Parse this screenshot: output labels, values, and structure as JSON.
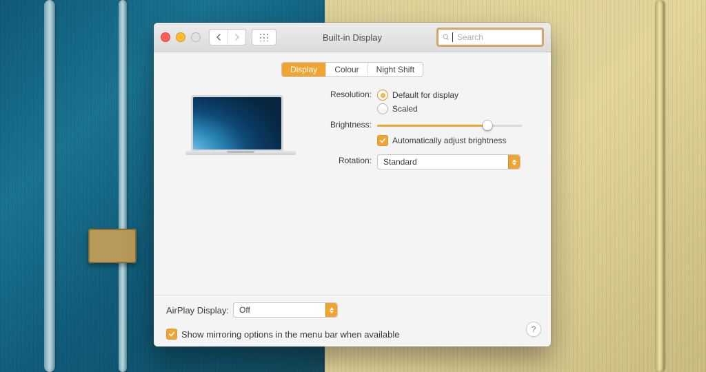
{
  "window": {
    "title": "Built-in Display",
    "search_placeholder": "Search",
    "search_value": ""
  },
  "tabs": {
    "items": [
      "Display",
      "Colour",
      "Night Shift"
    ],
    "active_index": 0
  },
  "form": {
    "resolution_label": "Resolution:",
    "resolution_default": "Default for display",
    "resolution_scaled": "Scaled",
    "resolution_selected": "default",
    "brightness_label": "Brightness:",
    "brightness_percent": 78,
    "auto_brightness_label": "Automatically adjust brightness",
    "auto_brightness_checked": true,
    "rotation_label": "Rotation:",
    "rotation_value": "Standard"
  },
  "footer": {
    "airplay_label": "AirPlay Display:",
    "airplay_value": "Off",
    "mirroring_label": "Show mirroring options in the menu bar when available",
    "mirroring_checked": true,
    "help_symbol": "?"
  },
  "colors": {
    "accent": "#f0a531"
  }
}
